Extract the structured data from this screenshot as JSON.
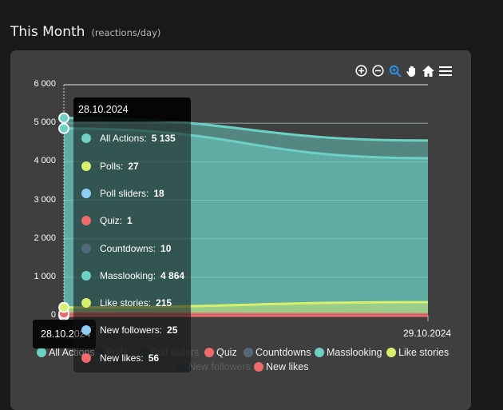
{
  "header": {
    "title": "This Month",
    "subtitle": "(reactions/day)"
  },
  "toolbar": {
    "icons": [
      "zoom-in-icon",
      "zoom-out-icon",
      "selection-zoom-icon",
      "pan-hand-icon",
      "reset-home-icon",
      "menu-icon"
    ],
    "active": "selection-zoom-icon",
    "active_color": "#2f8ee0"
  },
  "chart_data": {
    "type": "area",
    "title": "This Month (reactions/day)",
    "x": [
      "28.10.2024",
      "29.10.2024"
    ],
    "ylim": [
      0,
      6000
    ],
    "yticks": [
      "0",
      "1 000",
      "2 000",
      "3 000",
      "4 000",
      "5 000",
      "6 000"
    ],
    "grid": true,
    "legend_position": "bottom",
    "series": [
      {
        "name": "All Actions",
        "color": "#6cd0c5",
        "visible": true,
        "values": [
          5135,
          4550
        ]
      },
      {
        "name": "Polls",
        "color": "#d6f06e",
        "visible": false,
        "values": [
          27,
          27
        ]
      },
      {
        "name": "Poll sliders",
        "color": "#8ecdf5",
        "visible": false,
        "values": [
          18,
          18
        ]
      },
      {
        "name": "Quiz",
        "color": "#ee6b6b",
        "visible": true,
        "values": [
          1,
          1
        ]
      },
      {
        "name": "Countdowns",
        "color": "#546a7b",
        "visible": true,
        "values": [
          10,
          10
        ]
      },
      {
        "name": "Masslooking",
        "color": "#6cd0c5",
        "visible": true,
        "values": [
          4864,
          4090
        ]
      },
      {
        "name": "Like stories",
        "color": "#d6f06e",
        "visible": true,
        "values": [
          215,
          350
        ]
      },
      {
        "name": "New followers",
        "color": "#8ecdf5",
        "visible": false,
        "values": [
          25,
          25
        ]
      },
      {
        "name": "New likes",
        "color": "#ee6b6b",
        "visible": true,
        "values": [
          56,
          40
        ]
      }
    ]
  },
  "tooltip": {
    "date": "28.10.2024",
    "rows": [
      {
        "label": "All Actions:",
        "value": "5 135",
        "color": "#6cd0c5"
      },
      {
        "label": "Polls:",
        "value": "27",
        "color": "#d6f06e"
      },
      {
        "label": "Poll sliders:",
        "value": "18",
        "color": "#8ecdf5"
      },
      {
        "label": "Quiz:",
        "value": "1",
        "color": "#ee6b6b"
      },
      {
        "label": "Countdowns:",
        "value": "10",
        "color": "#546a7b"
      },
      {
        "label": "Masslooking:",
        "value": "4 864",
        "color": "#6cd0c5"
      },
      {
        "label": "Like stories:",
        "value": "215",
        "color": "#d6f06e"
      },
      {
        "label": "New followers:",
        "value": "25",
        "color": "#8ecdf5"
      },
      {
        "label": "New likes:",
        "value": "56",
        "color": "#ee6b6b"
      }
    ]
  },
  "x_tooltip": "28.10.2024",
  "legend": [
    {
      "label": "All Actions",
      "color": "#6cd0c5",
      "active": true
    },
    {
      "label": "Polls",
      "color": "#d6f06e",
      "active": false
    },
    {
      "label": "Poll sliders",
      "color": "#8ecdf5",
      "active": false
    },
    {
      "label": "Quiz",
      "color": "#ee6b6b",
      "active": true
    },
    {
      "label": "Countdowns",
      "color": "#546a7b",
      "active": true
    },
    {
      "label": "Masslooking",
      "color": "#6cd0c5",
      "active": true
    },
    {
      "label": "Like stories",
      "color": "#d6f06e",
      "active": true
    },
    {
      "label": "New followers",
      "color": "#8ecdf5",
      "active": false
    },
    {
      "label": "New likes",
      "color": "#ee6b6b",
      "active": true
    }
  ]
}
